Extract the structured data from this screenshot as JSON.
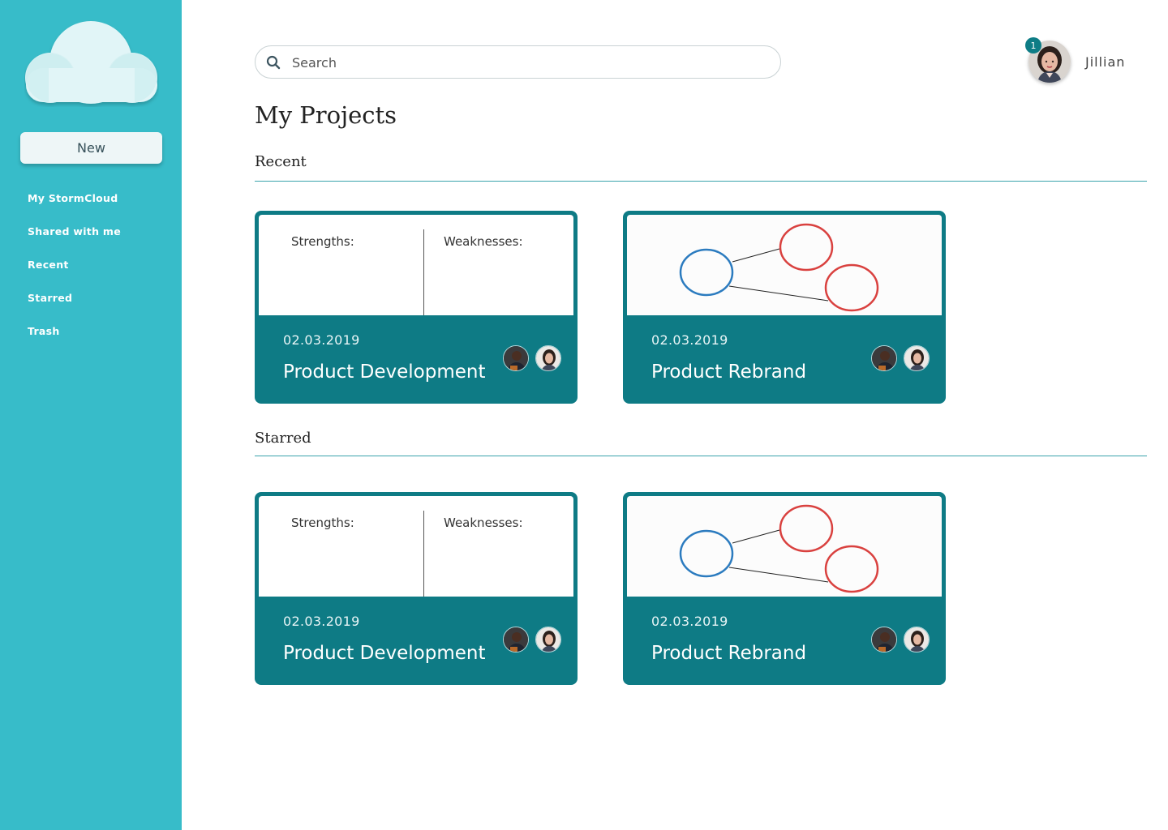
{
  "sidebar": {
    "new_label": "New",
    "items": [
      {
        "label": "My StormCloud"
      },
      {
        "label": "Shared with me"
      },
      {
        "label": "Recent"
      },
      {
        "label": "Starred"
      },
      {
        "label": "Trash"
      }
    ]
  },
  "search": {
    "placeholder": "Search",
    "value": ""
  },
  "user": {
    "name": "Jillian",
    "notifications": "1"
  },
  "page_title": "My Projects",
  "sections": [
    {
      "title": "Recent",
      "cards": [
        {
          "date": "02.03.2019",
          "title": "Product Development",
          "preview": "strengths-weaknesses",
          "left_label": "Strengths:",
          "right_label": "Weaknesses:"
        },
        {
          "date": "02.03.2019",
          "title": "Product Rebrand",
          "preview": "mind-map"
        }
      ]
    },
    {
      "title": "Starred",
      "cards": [
        {
          "date": "02.03.2019",
          "title": "Product Development",
          "preview": "strengths-weaknesses",
          "left_label": "Strengths:",
          "right_label": "Weaknesses:"
        },
        {
          "date": "02.03.2019",
          "title": "Product Rebrand",
          "preview": "mind-map"
        }
      ]
    }
  ],
  "icons": {
    "search": "search-icon",
    "logo": "cloud-logo-icon",
    "notification": "notification-badge"
  },
  "colors": {
    "sidebar": "#37bcc9",
    "accent": "#0e7b85",
    "rule": "#3aa3ac",
    "map_primary": "#2b7bbf",
    "map_secondary": "#d9413f"
  }
}
